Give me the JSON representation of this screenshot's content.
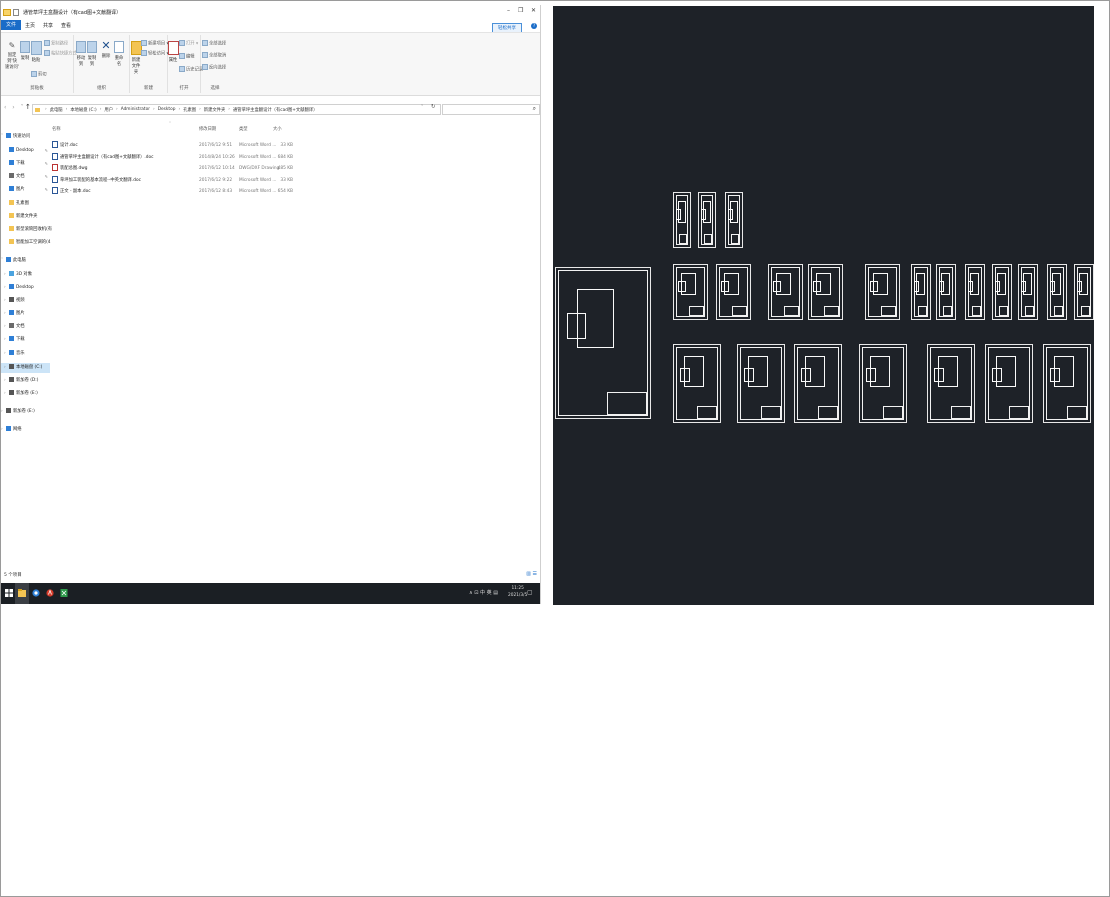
{
  "window": {
    "title": "通管草坪主盒翻设计（有cad图+文献翻译）",
    "controls": {
      "minimize": "–",
      "maximize": "❐",
      "close": "✕"
    }
  },
  "menu": {
    "file": "文件",
    "items": [
      "主页",
      "共享",
      "查看"
    ],
    "share_button": "轻松共享",
    "help": "?"
  },
  "ribbon": {
    "groups": {
      "clipboard": {
        "label": "剪贴板",
        "pin_line1": "固定到'快",
        "pin_line2": "速访问'",
        "copy": "复制",
        "paste": "粘贴",
        "copy_path": "复制路径",
        "paste_shortcut": "粘贴快捷方式",
        "cut": "剪切"
      },
      "organize": {
        "label": "组织",
        "move_to": "移动到",
        "copy_to": "复制到",
        "delete": "删除",
        "rename": "重命名"
      },
      "new": {
        "label": "新建",
        "new_folder_line1": "新建",
        "new_folder_line2": "文件夹",
        "new_item": "新建项目 ▾",
        "easy_access": "轻松访问 ▾"
      },
      "open": {
        "label": "打开",
        "properties": "属性",
        "open": "打开 ▾",
        "edit": "编辑",
        "history": "历史记录"
      },
      "select": {
        "label": "选择",
        "select_all": "全部选择",
        "select_none": "全部取消",
        "invert": "反向选择"
      }
    }
  },
  "address": {
    "nav_arrows": "‹ › ˅",
    "up": "↑",
    "breadcrumbs": [
      "此电脑",
      "本地磁盘 (C:)",
      "用户",
      "Administrator",
      "Desktop",
      "孔素图",
      "新建文件夹",
      "通管草坪主盒翻设计（有cad图+文献翻译）"
    ],
    "dropdown": "˅",
    "refresh": "↻",
    "search_placeholder": "",
    "search_icon": "⌕"
  },
  "nav_pane": {
    "items": [
      {
        "label": "快速访问",
        "caret": "˅",
        "icon": "star-icon",
        "indent": 0,
        "pinned": false
      },
      {
        "label": "Desktop",
        "caret": "",
        "icon": "desktop-icon",
        "indent": 1,
        "pinned": true
      },
      {
        "label": "下载",
        "caret": "",
        "icon": "download-icon",
        "indent": 1,
        "pinned": true
      },
      {
        "label": "文档",
        "caret": "",
        "icon": "document-icon",
        "indent": 1,
        "pinned": true
      },
      {
        "label": "图片",
        "caret": "",
        "icon": "picture-icon",
        "indent": 1,
        "pinned": true
      },
      {
        "label": "孔素图",
        "caret": "",
        "icon": "folder-icon",
        "indent": 1,
        "pinned": false
      },
      {
        "label": "新建文件夹",
        "caret": "",
        "icon": "folder-icon",
        "indent": 1,
        "pinned": false
      },
      {
        "label": "新型滚筒回收机(有",
        "caret": "",
        "icon": "folder-icon",
        "indent": 1,
        "pinned": false
      },
      {
        "label": "智能加工空调的(4",
        "caret": "",
        "icon": "folder-icon",
        "indent": 1,
        "pinned": false
      },
      {
        "label": "此电脑",
        "caret": "˅",
        "icon": "computer-icon",
        "indent": 0,
        "pinned": false
      },
      {
        "label": "3D 对象",
        "caret": "›",
        "icon": "cube-icon",
        "indent": 1,
        "pinned": false
      },
      {
        "label": "Desktop",
        "caret": "›",
        "icon": "desktop-icon",
        "indent": 1,
        "pinned": false
      },
      {
        "label": "视频",
        "caret": "›",
        "icon": "video-icon",
        "indent": 1,
        "pinned": false
      },
      {
        "label": "图片",
        "caret": "›",
        "icon": "picture-icon",
        "indent": 1,
        "pinned": false
      },
      {
        "label": "文档",
        "caret": "›",
        "icon": "document-icon",
        "indent": 1,
        "pinned": false
      },
      {
        "label": "下载",
        "caret": "›",
        "icon": "download-icon",
        "indent": 1,
        "pinned": false
      },
      {
        "label": "音乐",
        "caret": "›",
        "icon": "music-icon",
        "indent": 1,
        "pinned": false
      },
      {
        "label": "本地磁盘 (C:)",
        "caret": "›",
        "icon": "drive-icon",
        "indent": 1,
        "pinned": false,
        "selected": true
      },
      {
        "label": "新加卷 (D:)",
        "caret": "›",
        "icon": "drive-icon",
        "indent": 1,
        "pinned": false
      },
      {
        "label": "新加卷 (E:)",
        "caret": "›",
        "icon": "drive-icon",
        "indent": 1,
        "pinned": false
      },
      {
        "label": "新加卷 (E:)",
        "caret": "›",
        "icon": "drive-icon",
        "indent": 0,
        "pinned": false
      },
      {
        "label": "网络",
        "caret": "›",
        "icon": "network-icon",
        "indent": 0,
        "pinned": false
      }
    ]
  },
  "file_list": {
    "sort_caret": "˄",
    "columns": {
      "name": "名称",
      "date": "修改日期",
      "type": "类型",
      "size": "大小"
    },
    "rows": [
      {
        "name": "设计.doc",
        "date": "2017/6/12 9:51",
        "type": "Microsoft Word ...",
        "size": "33 KB",
        "kind": "doc"
      },
      {
        "name": "通管草坪主盒翻设计（有cad图+文献翻译）.doc",
        "date": "2014/8/24 10:26",
        "type": "Microsoft Word ...",
        "size": "684 KB",
        "kind": "doc"
      },
      {
        "name": "装配总图.dwg",
        "date": "2017/6/12 10:14",
        "type": "DWG/DXF Drawing",
        "size": "485 KB",
        "kind": "dwg"
      },
      {
        "name": "草坪加工装配的基本流程--中英文翻译.doc",
        "date": "2017/6/12 9:22",
        "type": "Microsoft Word ...",
        "size": "33 KB",
        "kind": "doc"
      },
      {
        "name": "正文 - 副本.doc",
        "date": "2017/6/12 8:43",
        "type": "Microsoft Word ...",
        "size": "654 KB",
        "kind": "doc"
      }
    ]
  },
  "status": {
    "item_count": "5 个项目",
    "view_buttons": "▥ ☰"
  },
  "taskbar": {
    "tray": "∧ ⊡ 中 英 ▤",
    "time": "11:25",
    "date": "2021/3/5",
    "notification": "▢"
  }
}
